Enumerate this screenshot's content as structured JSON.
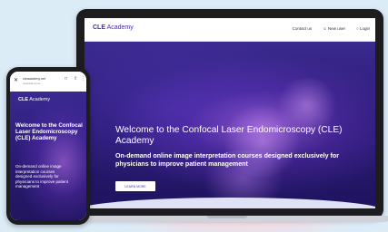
{
  "laptop": {
    "logo_main": "CLE",
    "logo_sub": "Academy",
    "nav": [
      "Contact us",
      "New user",
      "Login"
    ],
    "hero_title": "Welcome to the Confocal Laser Endomicroscopy (CLE) Academy",
    "hero_subtitle": "On-demand online image interpretation courses designed exclusively for physicians to improve patient management",
    "hero_button": "LEARN MORE"
  },
  "phone": {
    "url": "cleacademy.net",
    "url_sub": "cleacademy.net",
    "logo_main": "CLE",
    "logo_sub": "Academy",
    "hero_title": "Welcome to the Confocal Laser Endomicroscopy (CLE) Academy",
    "hero_subtitle": "On-demand online image interpretation courses designed exclusively for physicians to improve patient management"
  },
  "colors": {
    "background": "#dcecf7",
    "brand_purple": "#4b2f9b",
    "hero_dark": "#2a1a72"
  },
  "icons": {
    "phone_close": "×",
    "phone_bookmark": "☐",
    "phone_share": "⤴",
    "phone_more": "⋮",
    "user": "👤",
    "lock": "🔒"
  }
}
